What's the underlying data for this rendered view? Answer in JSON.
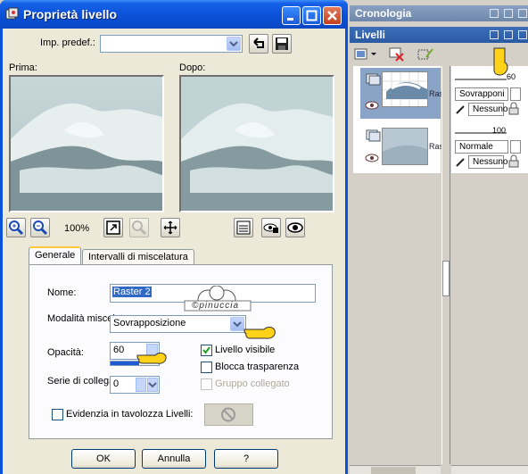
{
  "dialog": {
    "title": "Proprietà livello",
    "preset_label": "Imp. predef.:",
    "preset_value": "",
    "before_label": "Prima:",
    "after_label": "Dopo:",
    "zoom_level": "100%"
  },
  "tabs": [
    {
      "label": "Generale",
      "active": true
    },
    {
      "label": "Intervalli di miscelatura",
      "active": false
    }
  ],
  "general": {
    "name_label": "Nome:",
    "name_value": "Raster 2",
    "blend_mode_label": "Modalità miscelatura:",
    "blend_mode_value": "Sovrapposizione",
    "opacity_label": "Opacità:",
    "opacity_value": "60",
    "link_set_label": "Serie di collegamenti:",
    "link_set_value": "0",
    "visible_label": "Livello visibile",
    "visible_checked": true,
    "lock_transparency_label": "Blocca trasparenza",
    "lock_transparency_checked": false,
    "group_link_label": "Gruppo collegato",
    "group_link_checked": false,
    "highlight_label": "Evidenzia in tavolozza Livelli:",
    "highlight_checked": false
  },
  "buttons": {
    "ok": "OK",
    "cancel": "Annulla",
    "help": "?"
  },
  "watermark": "©pinuccia",
  "palettes": {
    "history_title": "Cronologia",
    "layers_title": "Livelli",
    "layers": [
      {
        "name": "Rast",
        "opacity": "60",
        "blend": "Sovrapponi",
        "group": "Nessuno"
      },
      {
        "name": "Ras",
        "opacity": "100",
        "blend": "Normale",
        "group": "Nessuno"
      }
    ]
  },
  "colors": {
    "title_blue": "#0a4fd6",
    "dialog_bg": "#ece9d8",
    "palette_bg": "#d4d0c8",
    "layer_selected": "#8aa4c8"
  }
}
